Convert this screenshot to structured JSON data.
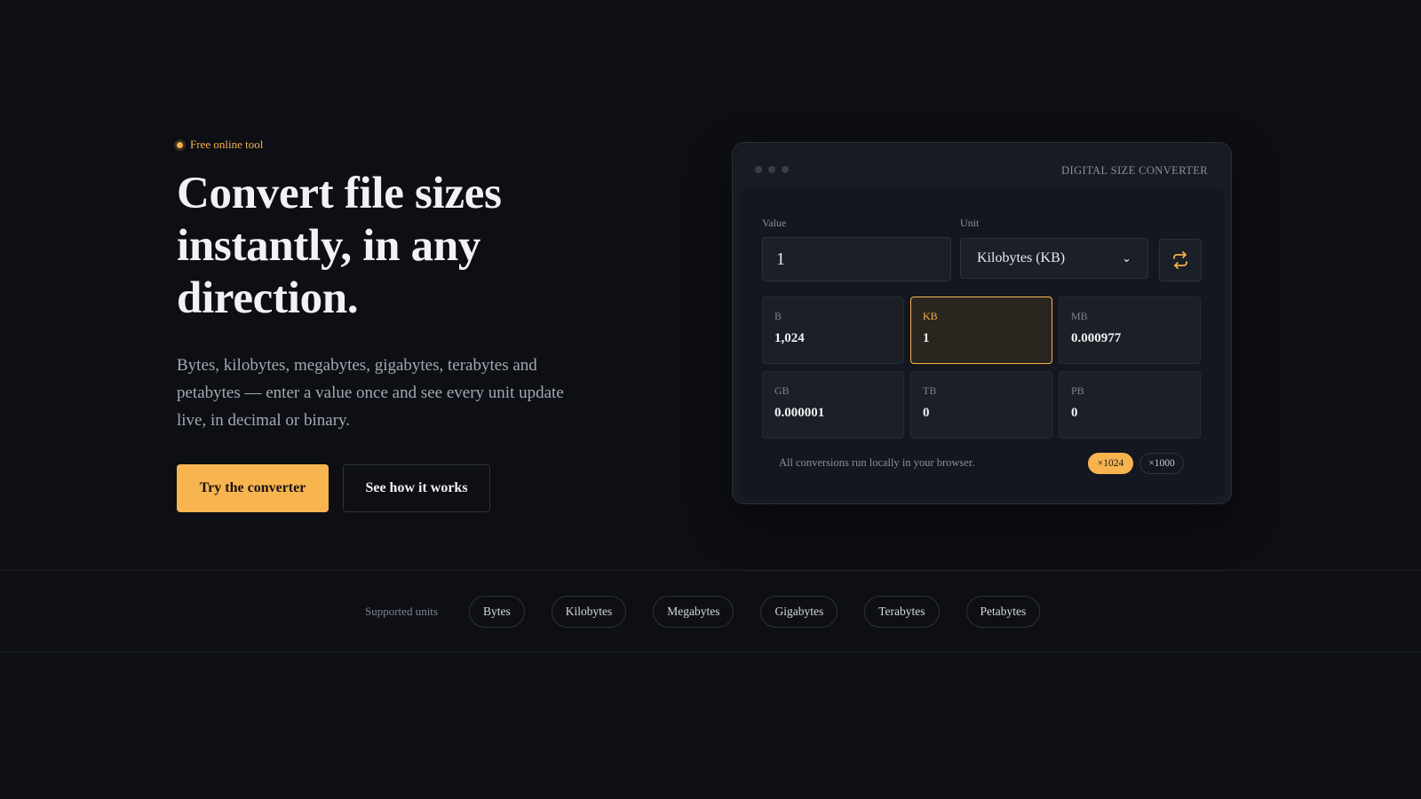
{
  "hero": {
    "tag": "Free online tool",
    "headline_line1": "Convert file sizes",
    "headline_line2": "instantly, in any",
    "headline_line3": "direction.",
    "subtext": "Bytes, kilobytes, megabytes, gigabytes, terabytes and petabytes — enter a value once and see every unit update live, in decimal or binary.",
    "primary_cta": "Try the converter",
    "secondary_cta": "See how it works"
  },
  "converter": {
    "title": "DIGITAL SIZE CONVERTER",
    "value_label": "Value",
    "value": "1",
    "unit_label": "Unit",
    "unit_selected": "Kilobytes (KB)",
    "results": [
      {
        "unit": "B",
        "value": "1,024",
        "active": false
      },
      {
        "unit": "KB",
        "value": "1",
        "active": true
      },
      {
        "unit": "MB",
        "value": "0.000977",
        "active": false
      },
      {
        "unit": "GB",
        "value": "0.000001",
        "active": false
      },
      {
        "unit": "TB",
        "value": "0",
        "active": false
      },
      {
        "unit": "PB",
        "value": "0",
        "active": false
      }
    ],
    "note": "All conversions run locally in your browser.",
    "mode_binary": "×1024",
    "mode_decimal": "×1000"
  },
  "units_strip": {
    "label": "Supported units",
    "units": [
      "Bytes",
      "Kilobytes",
      "Megabytes",
      "Gigabytes",
      "Terabytes",
      "Petabytes"
    ]
  },
  "colors": {
    "accent": "#f8b44f",
    "background": "#0d0f14",
    "card": "#181b22"
  }
}
